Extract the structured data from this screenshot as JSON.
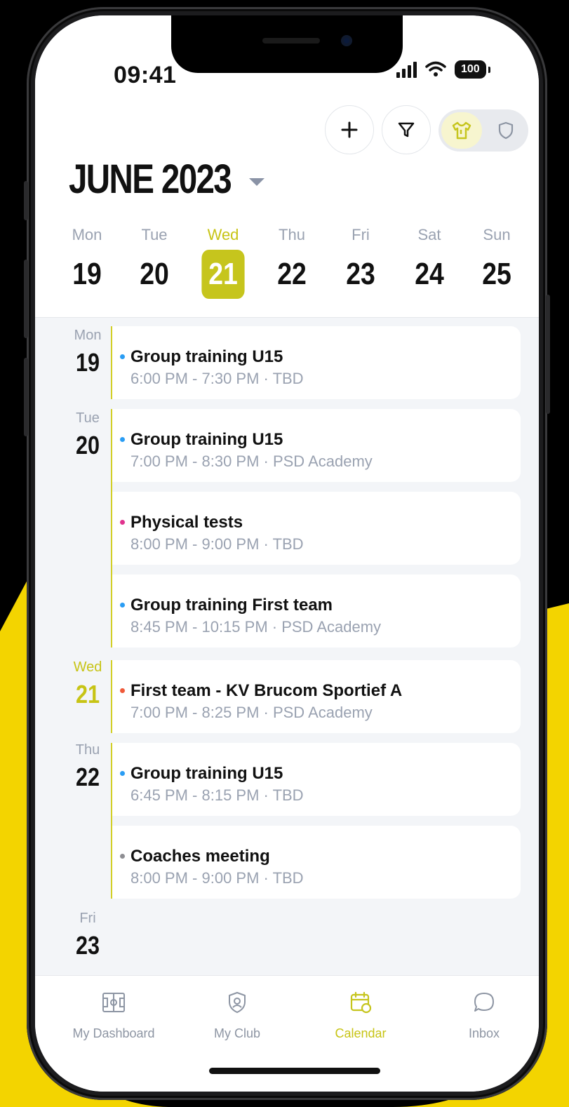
{
  "status": {
    "time": "09:41",
    "battery": "100"
  },
  "header": {
    "month": "JUNE 2023"
  },
  "colors": {
    "accent": "#c6c51d",
    "brand_yellow": "#f3d400",
    "training": "#2a9df4",
    "tests": "#e0338e",
    "match": "#ef5a3a",
    "meeting": "#8e8e93"
  },
  "week": [
    {
      "name": "Mon",
      "num": "19"
    },
    {
      "name": "Tue",
      "num": "20"
    },
    {
      "name": "Wed",
      "num": "21",
      "active": true
    },
    {
      "name": "Thu",
      "num": "22"
    },
    {
      "name": "Fri",
      "num": "23"
    },
    {
      "name": "Sat",
      "num": "24"
    },
    {
      "name": "Sun",
      "num": "25"
    }
  ],
  "days": [
    {
      "name": "Mon",
      "num": "19"
    },
    {
      "name": "Tue",
      "num": "20"
    },
    {
      "name": "Wed",
      "num": "21"
    },
    {
      "name": "Thu",
      "num": "22"
    },
    {
      "name": "Fri",
      "num": "23"
    }
  ],
  "events": [
    {
      "title": "Group training U15",
      "time": "6:00 PM - 7:30 PM · TBD",
      "type": "training"
    },
    {
      "title": "Group training U15",
      "time": "7:00 PM - 8:30 PM · PSD Academy",
      "type": "training"
    },
    {
      "title": "Physical tests",
      "time": "8:00 PM - 9:00 PM · TBD",
      "type": "tests"
    },
    {
      "title": "Group training First team",
      "time": "8:45 PM - 10:15 PM · PSD Academy",
      "type": "training"
    },
    {
      "title": "First team - KV Brucom Sportief A",
      "time": "7:00 PM - 8:25 PM · PSD Academy",
      "type": "match"
    },
    {
      "title": "Group training U15",
      "time": "6:45 PM - 8:15 PM · TBD",
      "type": "training"
    },
    {
      "title": "Coaches meeting",
      "time": "8:00 PM - 9:00 PM · TBD",
      "type": "meeting"
    }
  ],
  "tabs": [
    {
      "label": "My Dashboard",
      "icon": "dashboard-icon"
    },
    {
      "label": "My Club",
      "icon": "club-icon"
    },
    {
      "label": "Calendar",
      "icon": "calendar-icon",
      "active": true
    },
    {
      "label": "Inbox",
      "icon": "inbox-icon"
    }
  ]
}
